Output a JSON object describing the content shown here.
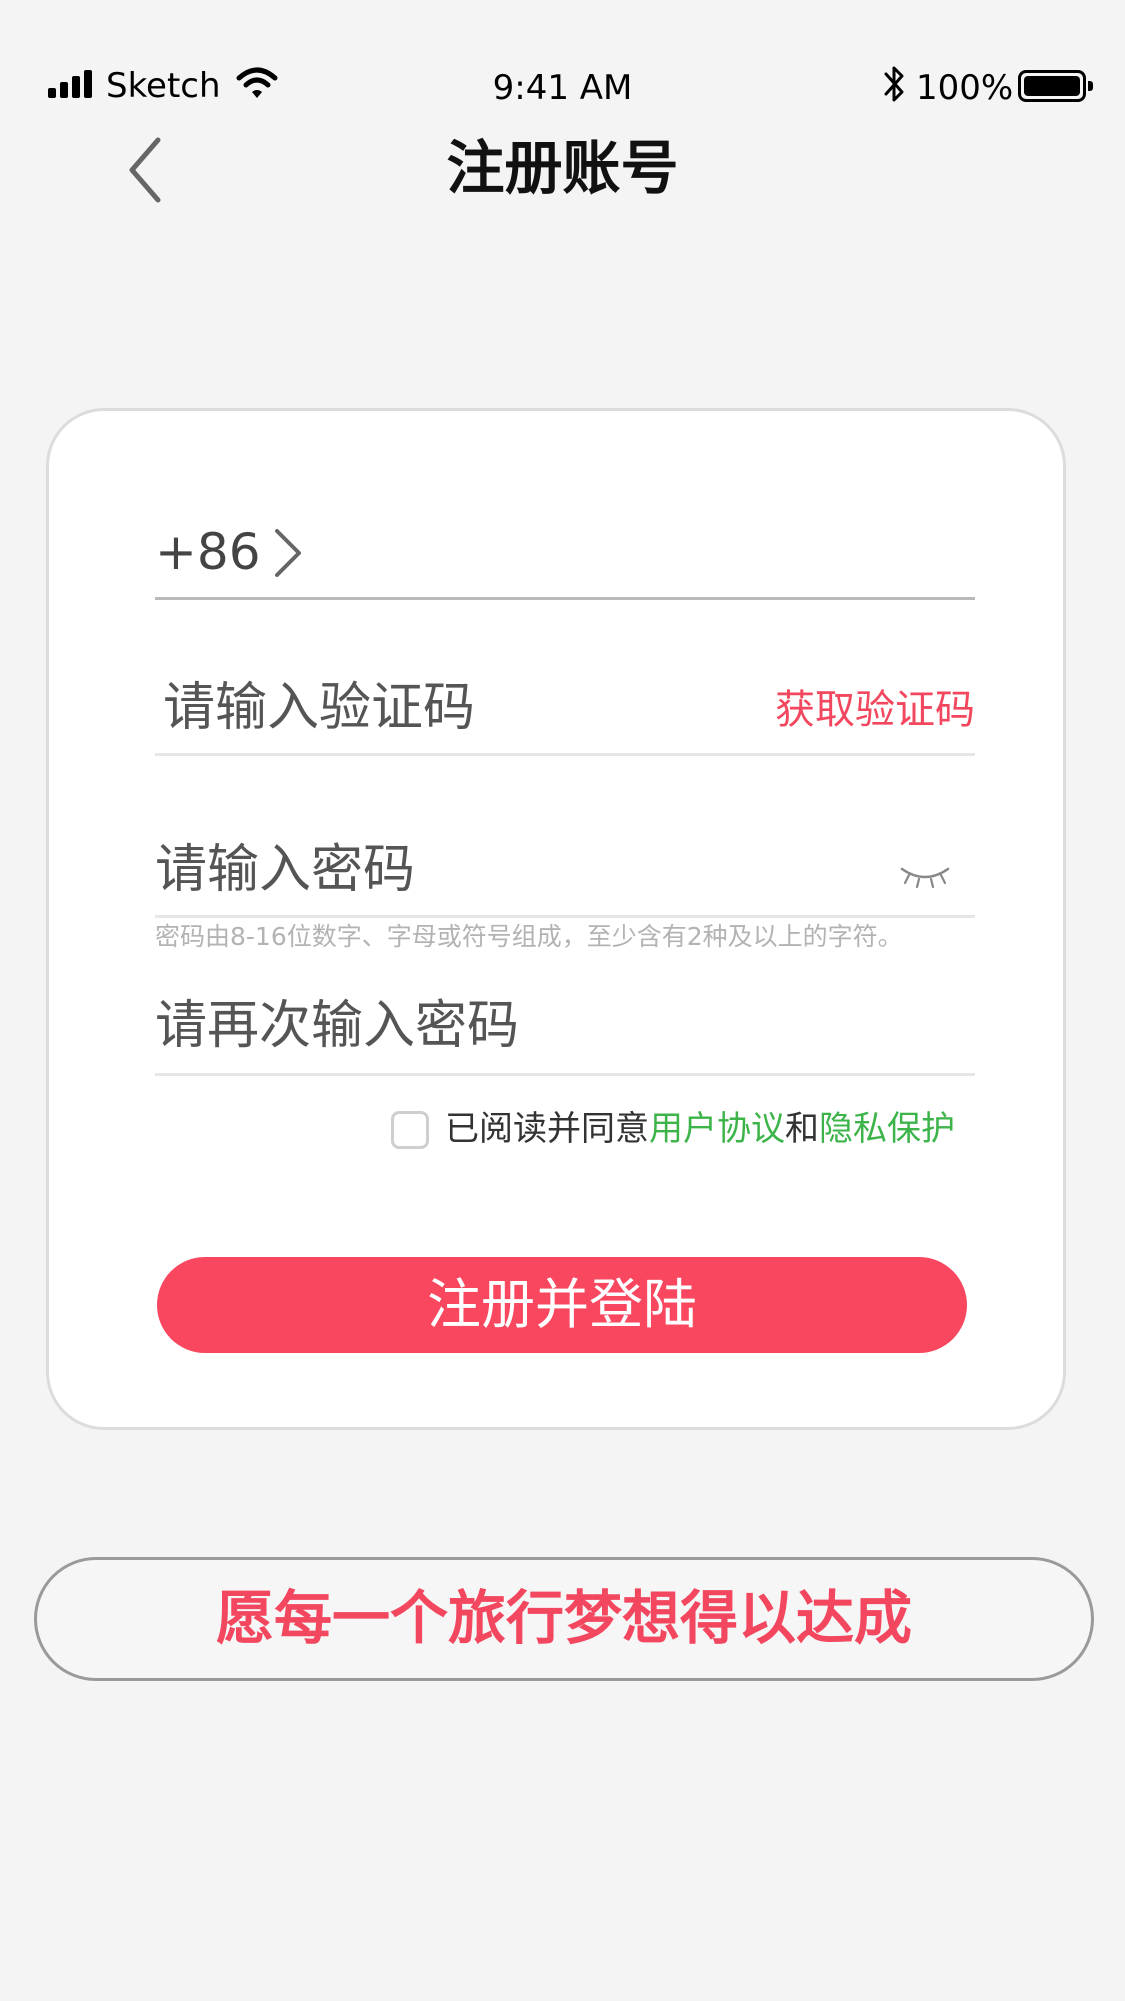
{
  "status_bar": {
    "carrier": "Sketch",
    "time": "9:41 AM",
    "battery_percent": "100%",
    "battery_level": 1.0
  },
  "nav": {
    "title": "注册账号",
    "back_icon": "chevron-left-icon"
  },
  "form": {
    "country_code": "+86",
    "code_placeholder": "请输入验证码",
    "get_code_label": "获取验证码",
    "password_placeholder": "请输入密码",
    "password_hint": "密码由8-16位数字、字母或符号组成，至少含有2种及以上的字符。",
    "password_confirm_placeholder": "请再次输入密码",
    "agreement": {
      "checked": false,
      "prefix": "已阅读并同意",
      "user_agreement": "用户协议",
      "and": "和",
      "privacy": "隐私保护"
    },
    "submit_label": "注册并登陆"
  },
  "slogan": "愿每一个旅行梦想得以达成",
  "colors": {
    "accent": "#f8475f",
    "accent_text": "#f2475e",
    "link_green": "#3cb44a",
    "background": "#f4f4f4",
    "card": "#ffffff"
  }
}
